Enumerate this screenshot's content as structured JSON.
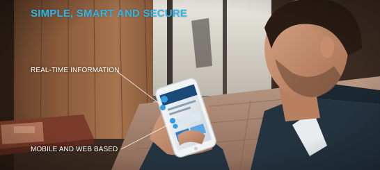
{
  "overlay": {
    "headline": "SIMPLE, SMART AND SECURE",
    "callout_realtime": "REAL-TIME INFORMATION",
    "callout_mobile_web": "MOBILE AND WEB BASED",
    "accent_color": "#2fb6e8",
    "label_color": "#ffffff"
  },
  "scene": {
    "description_icons": [
      "phone-screen",
      "bubble-icon-blue",
      "bubble-icon-blue-small"
    ]
  }
}
